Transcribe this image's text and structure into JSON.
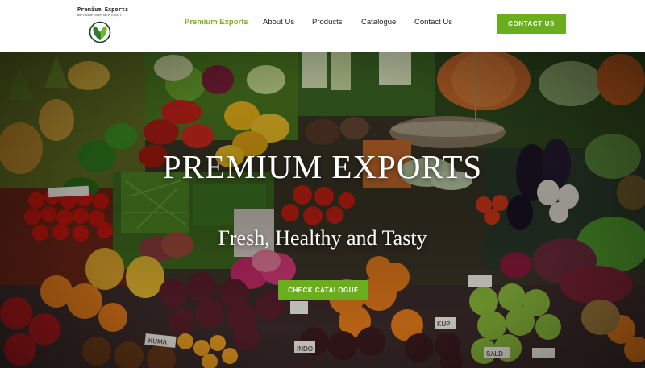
{
  "header": {
    "logo": {
      "title": "Premium Exports",
      "tagline": "Worldwide Vegetable Export",
      "icon": "leaf-logo-icon"
    },
    "nav": [
      {
        "label": "Premium Exports",
        "active": true
      },
      {
        "label": "About Us",
        "active": false
      },
      {
        "label": "Products",
        "active": false
      },
      {
        "label": "Catalogue",
        "active": false
      },
      {
        "label": "Contact Us",
        "active": false
      }
    ],
    "cta_label": "CONTACT US"
  },
  "hero": {
    "title": "PREMIUM EXPORTS",
    "subtitle": "Fresh, Healthy and Tasty",
    "button_label": "CHECK CATALOGUE"
  },
  "colors": {
    "accent": "#6aad1d",
    "nav_active": "#7bb324",
    "text": "#222222"
  }
}
